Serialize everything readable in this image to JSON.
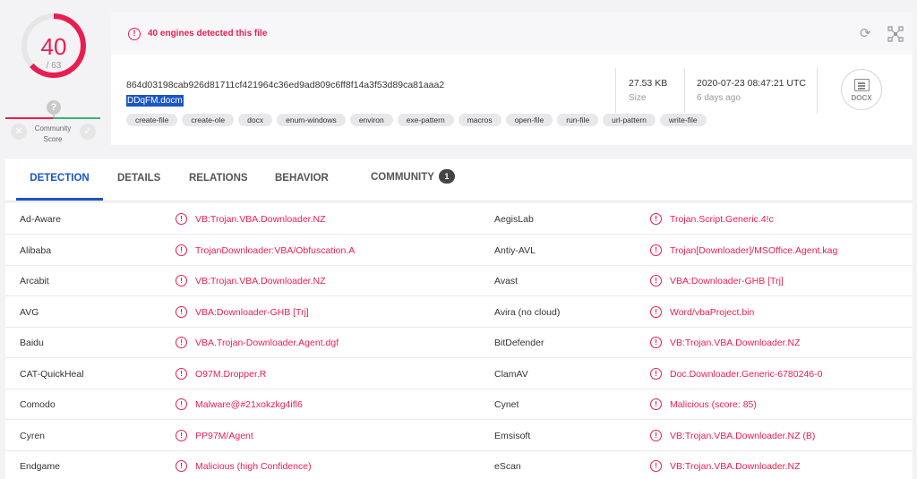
{
  "score": {
    "detections": "40",
    "total": "/ 63",
    "community_label": "Community\nScore",
    "community_marker": "?",
    "colors": {
      "malicious": "#e91e50",
      "harmless": "#3bb273"
    }
  },
  "alert": {
    "icon": "alert-circle-icon",
    "text": "40 engines detected this file"
  },
  "file": {
    "hash": "864d03198cab926d81711cf421964c36ed9ad809c6ff8f14a3f53d89ca81aaa2",
    "name": "DDqFM.docm",
    "size": "27.53 KB",
    "size_label": "Size",
    "date": "2020-07-23 08:47:21 UTC",
    "date_ago": "6 days ago",
    "type_badge": "DOCX",
    "tags": [
      "create-file",
      "create-ole",
      "docx",
      "enum-windows",
      "environ",
      "exe-pattern",
      "macros",
      "open-file",
      "run-file",
      "url-pattern",
      "write-file"
    ]
  },
  "tabs": [
    {
      "label": "DETECTION"
    },
    {
      "label": "DETAILS"
    },
    {
      "label": "RELATIONS"
    },
    {
      "label": "BEHAVIOR"
    },
    {
      "label": "COMMUNITY",
      "count": "1"
    }
  ],
  "detections": [
    {
      "left": {
        "engine": "Ad-Aware",
        "result": "VB:Trojan.VBA.Downloader.NZ"
      },
      "right": {
        "engine": "AegisLab",
        "result": "Trojan.Script.Generic.4!c"
      }
    },
    {
      "left": {
        "engine": "Alibaba",
        "result": "TrojanDownloader:VBA/Obfuscation.A"
      },
      "right": {
        "engine": "Antiy-AVL",
        "result": "Trojan[Downloader]/MSOffice.Agent.kag"
      }
    },
    {
      "left": {
        "engine": "Arcabit",
        "result": "VB:Trojan.VBA.Downloader.NZ"
      },
      "right": {
        "engine": "Avast",
        "result": "VBA:Downloader-GHB [Trj]"
      }
    },
    {
      "left": {
        "engine": "AVG",
        "result": "VBA:Downloader-GHB [Trj]"
      },
      "right": {
        "engine": "Avira (no cloud)",
        "result": "Word/vbaProject.bin"
      }
    },
    {
      "left": {
        "engine": "Baidu",
        "result": "VBA.Trojan-Downloader.Agent.dgf"
      },
      "right": {
        "engine": "BitDefender",
        "result": "VB:Trojan.VBA.Downloader.NZ"
      }
    },
    {
      "left": {
        "engine": "CAT-QuickHeal",
        "result": "O97M.Dropper.R"
      },
      "right": {
        "engine": "ClamAV",
        "result": "Doc.Downloader.Generic-6780246-0"
      }
    },
    {
      "left": {
        "engine": "Comodo",
        "result": "Malware@#21xokzkg4ifl6"
      },
      "right": {
        "engine": "Cynet",
        "result": "Malicious (score: 85)"
      }
    },
    {
      "left": {
        "engine": "Cyren",
        "result": "PP97M/Agent"
      },
      "right": {
        "engine": "Emsisoft",
        "result": "VB:Trojan.VBA.Downloader.NZ (B)"
      }
    },
    {
      "left": {
        "engine": "Endgame",
        "result": "Malicious (high Confidence)"
      },
      "right": {
        "engine": "eScan",
        "result": "VB:Trojan.VBA.Downloader.NZ"
      }
    }
  ]
}
